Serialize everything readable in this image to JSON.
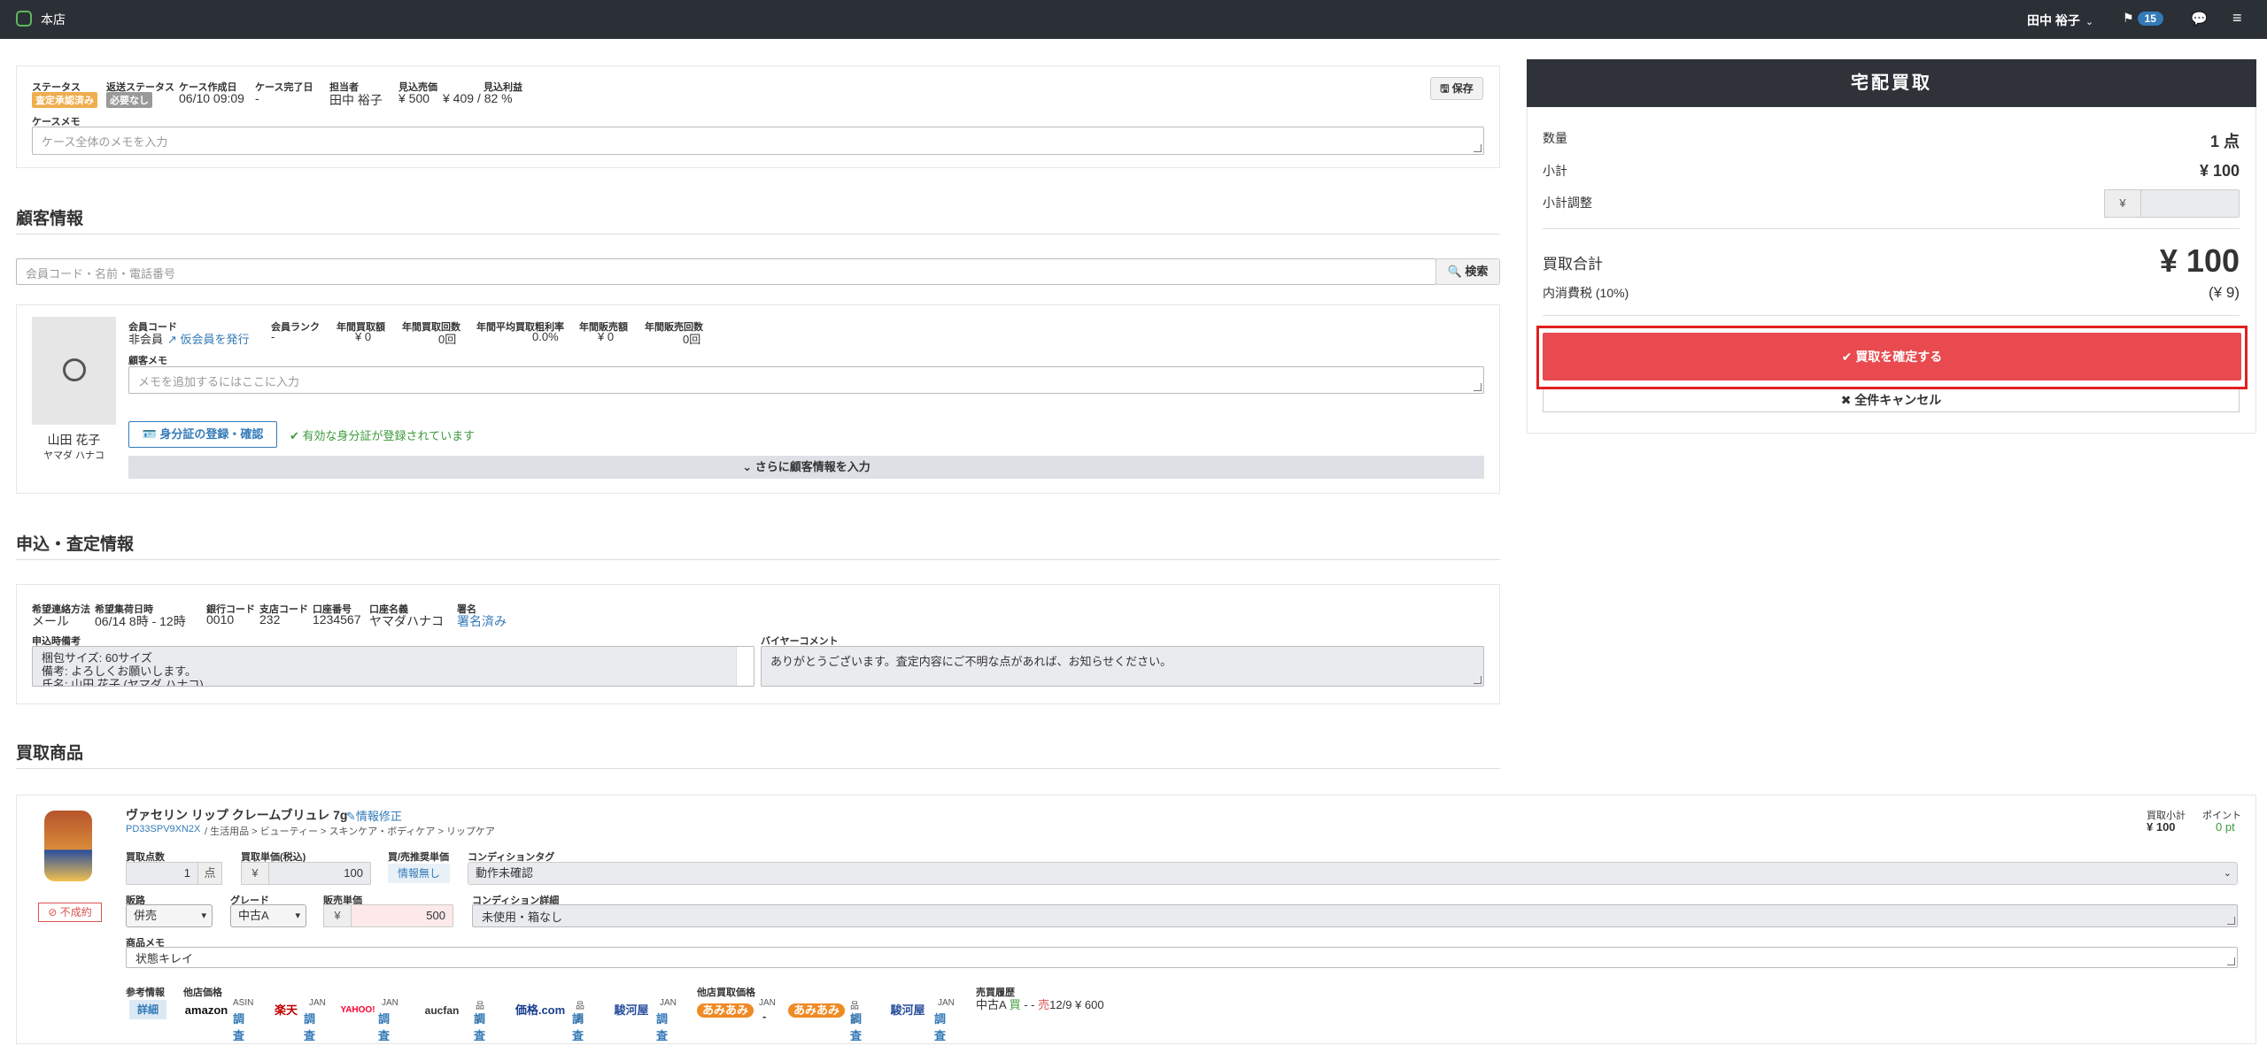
{
  "topbar": {
    "store": "本店",
    "user": "田中 裕子",
    "flag_count": "15"
  },
  "case": {
    "status_label": "ステータス",
    "status_value": "査定承認済み",
    "return_status_label": "返送ステータス",
    "return_status_value": "必要なし",
    "created_label": "ケース作成日",
    "created_value": "06/10 09:09",
    "completed_label": "ケース完了日",
    "completed_value": "-",
    "staff_label": "担当者",
    "staff_value": "田中 裕子",
    "sales_label": "見込売価",
    "sales_value": "¥ 500",
    "profit_label": "見込利益",
    "profit_value": "¥ 409 / 82 %",
    "save_label": "保存",
    "memo_label": "ケースメモ",
    "memo_placeholder": "ケース全体のメモを入力"
  },
  "customer": {
    "title": "顧客情報",
    "search_placeholder": "会員コード・名前・電話番号",
    "search_button": "検索",
    "name": "山田 花子",
    "kana": "ヤマダ ハナコ",
    "code_label": "会員コード",
    "code_value": "非会員",
    "issue_link": "仮会員を発行",
    "rank_label": "会員ランク",
    "rank_value": "-",
    "annual_buy_label": "年間買取額",
    "annual_buy_value": "¥ 0",
    "annual_buy_count_label": "年間買取回数",
    "annual_buy_count_value": "0回",
    "avg_rate_label": "年間平均買取粗利率",
    "avg_rate_value": "0.0%",
    "annual_sales_label": "年間販売額",
    "annual_sales_value": "¥ 0",
    "annual_sales_count_label": "年間販売回数",
    "annual_sales_count_value": "0回",
    "memo_label": "顧客メモ",
    "memo_placeholder": "メモを追加するにはここに入力",
    "id_button": "身分証の登録・確認",
    "id_status": "有効な身分証が登録されています",
    "more_button": "さらに顧客情報を入力"
  },
  "application": {
    "title": "申込・査定情報",
    "contact_label": "希望連絡方法",
    "contact_value": "メール",
    "pickup_label": "希望集荷日時",
    "pickup_value": "06/14 8時 - 12時",
    "bank_label": "銀行コード",
    "bank_value": "0010",
    "branch_label": "支店コード",
    "branch_value": "232",
    "account_label": "口座番号",
    "account_value": "1234567",
    "holder_label": "口座名義",
    "holder_value": "ヤマダハナコ",
    "sign_label": "署名",
    "sign_value": "署名済み",
    "notes_label": "申込時備考",
    "notes_line1": "梱包サイズ: 60サイズ",
    "notes_line2": "備考: よろしくお願いします。",
    "notes_line3": "氏名: 山田 花子 (ヤマダ ハナコ)",
    "buyer_comment_label": "バイヤーコメント",
    "buyer_comment_value": "ありがとうございます。査定内容にご不明な点があれば、お知らせください。"
  },
  "items": {
    "title": "買取商品",
    "name": "ヴァセリン リップ クレームブリュレ 7g",
    "edit_link": "情報修正",
    "code": "PD33SPV9XN2X",
    "category": "/ 生活用品 > ビューティー > スキンケア・ボディケア > リップケア",
    "not_contracted": "不成約",
    "qty_label": "買取点数",
    "qty_value": "1",
    "qty_unit": "点",
    "unit_price_label": "買取単価(税込)",
    "unit_price_value": "100",
    "yen": "¥",
    "recommend_label": "買/売推奨単価",
    "recommend_value": "情報無し",
    "condition_tag_label": "コンディションタグ",
    "condition_tag_value": "動作未確認",
    "channel_label": "販路",
    "channel_value": "併売",
    "grade_label": "グレード",
    "grade_value": "中古A",
    "sale_price_label": "販売単価",
    "sale_price_value": "500",
    "condition_detail_label": "コンディション詳細",
    "condition_detail_value": "未使用・箱なし",
    "memo_label": "商品メモ",
    "memo_value": "状態キレイ",
    "ref_label": "参考情報",
    "ref_button": "詳細",
    "other_price_label": "他店価格",
    "other_buy_label": "他店買取価格",
    "history_label": "売買履歴",
    "history_grade": "中古A",
    "history_buy": "買",
    "history_sep": " - - ",
    "history_sell": "売",
    "history_tail": "12/9 ¥ 600",
    "subtotal_label": "買取小計",
    "subtotal_value": "¥ 100",
    "point_label": "ポイント",
    "point_value": "0 pt",
    "markets": [
      {
        "logo": "amazon",
        "kind": "ASIN",
        "check": "調査"
      },
      {
        "logo": "楽天",
        "kind": "JAN",
        "check": "調査"
      },
      {
        "logo": "YAHOO!",
        "kind": "JAN",
        "check": "調査"
      },
      {
        "logo": "aucfan",
        "kind": "品名",
        "check": "調査"
      },
      {
        "logo": "価格.com",
        "kind": "品名",
        "check": "調査"
      },
      {
        "logo": "駿河屋",
        "kind": "JAN",
        "check": "調査"
      }
    ],
    "buy_markets": [
      {
        "logo": "あみあみ",
        "kind": "JAN",
        "check": "-"
      },
      {
        "logo": "あみあみ",
        "kind": "品名",
        "check": "調査"
      },
      {
        "logo": "駿河屋",
        "kind": "JAN",
        "check": "調査"
      }
    ]
  },
  "summary": {
    "title": "宅配買取",
    "qty_label": "数量",
    "qty_value": "1 点",
    "subtotal_label": "小計",
    "subtotal_value": "¥ 100",
    "adjust_label": "小計調整",
    "adjust_yen": "¥",
    "total_label": "買取合計",
    "total_value": "¥ 100",
    "tax_label": "内消費税 (10%)",
    "tax_value": "(¥ 9)",
    "confirm_button": "買取を確定する",
    "cancel_button": "全件キャンセル"
  },
  "colors": {
    "status_tag": "#f0ad4e",
    "return_tag": "#999999",
    "confirm": "#e84a4f",
    "highlight": "#e02020",
    "topbar": "#2b2f36"
  }
}
